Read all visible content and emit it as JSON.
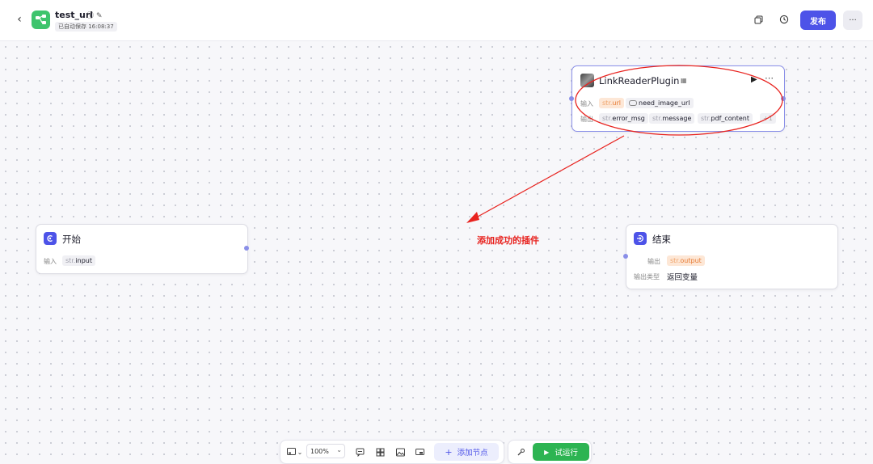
{
  "header": {
    "back_icon": "chevron-left-icon",
    "app_icon": "workflow-icon",
    "title": "test_url",
    "title_icons": [
      "info-icon",
      "edit-icon"
    ],
    "autosave": "已自动保存 16:08:37",
    "right_icons": [
      "copy-icon",
      "history-icon"
    ],
    "publish_label": "发布",
    "more_label": "···"
  },
  "nodes": {
    "start": {
      "title": "开始",
      "input_label": "输入",
      "input_tag_prefix": "str.",
      "input_tag_name": "input"
    },
    "plugin": {
      "title": "LinkReaderPlugin",
      "input_label": "输入",
      "output_label": "输出",
      "inputs": [
        {
          "prefix": "str.",
          "name": "url",
          "style": "orange"
        },
        {
          "prefix": "",
          "name": "need_image_url",
          "style": "grey",
          "toggle": true
        }
      ],
      "outputs": [
        {
          "prefix": "str.",
          "name": "error_msg"
        },
        {
          "prefix": "str.",
          "name": "message"
        },
        {
          "prefix": "str.",
          "name": "pdf_content"
        }
      ],
      "more_outputs": "+1"
    },
    "end": {
      "title": "结束",
      "output_label": "输出",
      "output_tag_prefix": "str.",
      "output_tag_name": "output",
      "output_type_label": "输出类型",
      "output_type_value": "返回变量"
    }
  },
  "annotation": {
    "text": "添加成功的插件",
    "color": "#e8231f"
  },
  "toolbar": {
    "zoom": "100%",
    "add_node_label": "添加节点",
    "run_label": "试运行"
  },
  "colors": {
    "accent": "#4d53e8",
    "run_green": "#2db452",
    "app_icon_green": "#3ec46d"
  }
}
